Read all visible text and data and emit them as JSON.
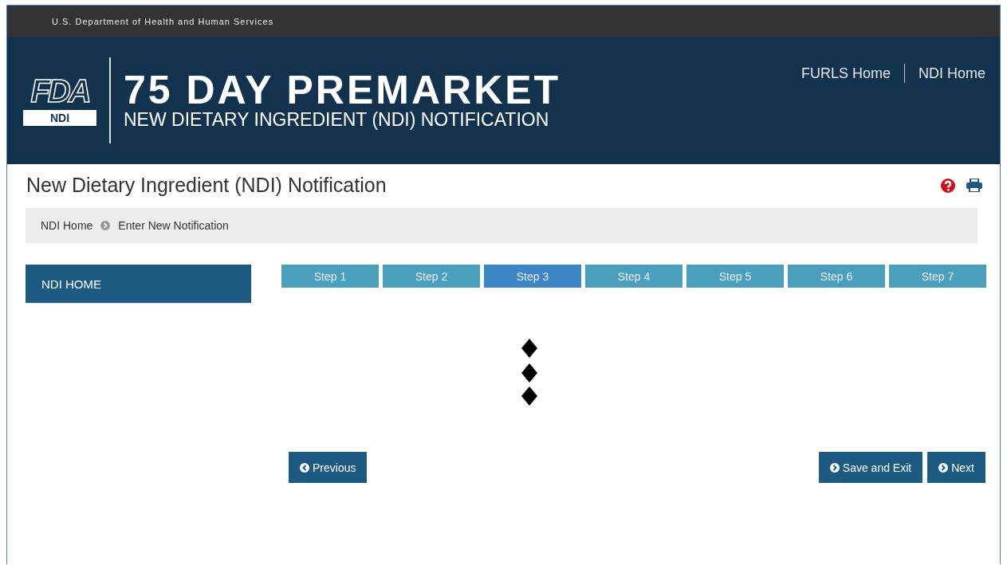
{
  "top_bar": {
    "agency": "U.S. Department of Health and Human Services"
  },
  "header": {
    "logo": {
      "mark": "FDA",
      "badge": "NDI"
    },
    "title": "75 DAY PREMARKET",
    "subtitle": "NEW DIETARY INGREDIENT (NDI) NOTIFICATION",
    "links": [
      "FURLS Home",
      "NDI Home"
    ]
  },
  "page": {
    "title": "New Dietary Ingredient (NDI) Notification"
  },
  "breadcrumb": [
    "NDI Home",
    "Enter New Notification"
  ],
  "sidebar": {
    "items": [
      {
        "label": "NDI HOME",
        "selected": true
      }
    ]
  },
  "steps": [
    {
      "label": "Step 1",
      "selected": false
    },
    {
      "label": "Step 2",
      "selected": false
    },
    {
      "label": "Step 3",
      "selected": true
    },
    {
      "label": "Step 4",
      "selected": false
    },
    {
      "label": "Step 5",
      "selected": false
    },
    {
      "label": "Step 6",
      "selected": false
    },
    {
      "label": "Step 7",
      "selected": false
    }
  ],
  "buttons": [
    {
      "label": "Previous",
      "kind": "back"
    },
    {
      "label": "Save and Exit",
      "kind": "forward"
    },
    {
      "label": "Next",
      "kind": "forward"
    }
  ]
}
